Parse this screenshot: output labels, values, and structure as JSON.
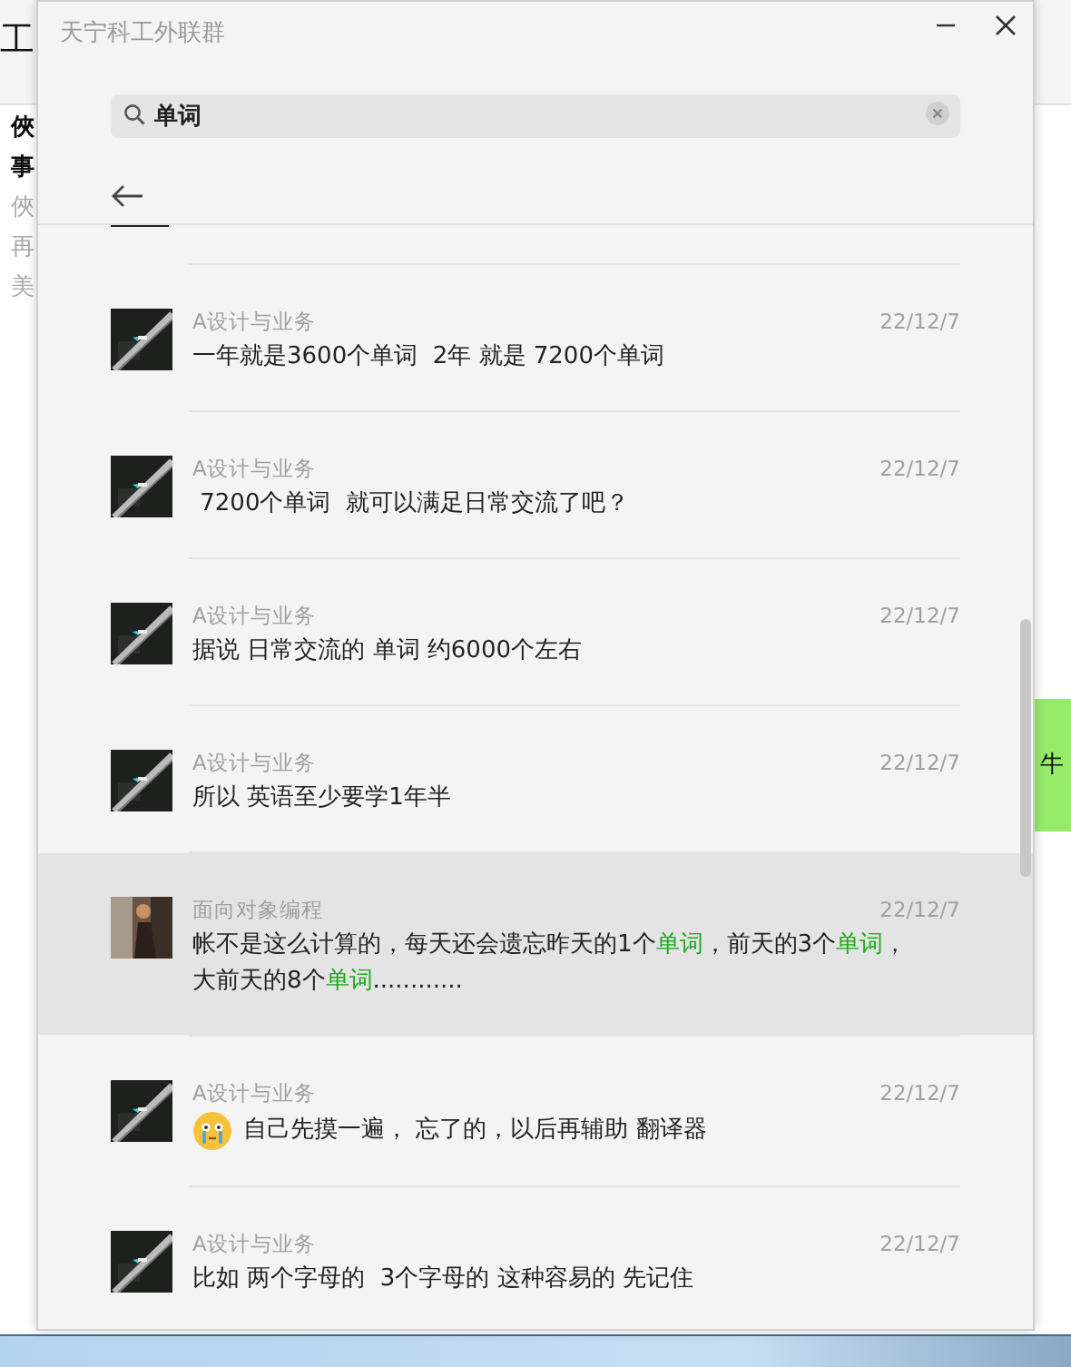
{
  "background_window": {
    "title_fragment": "工",
    "preview_lines": [
      {
        "text": "俠",
        "bold": true
      },
      {
        "text": "事",
        "bold": true
      },
      {
        "text": "俠",
        "bold": false
      },
      {
        "text": "再",
        "bold": false
      },
      {
        "text": "美",
        "bold": false
      }
    ],
    "bubble_fragment": "牛"
  },
  "window": {
    "title": "天宁科工外联群"
  },
  "search": {
    "value": "单词"
  },
  "results": [
    {
      "sender": "A设计与业务",
      "date": "22/12/7",
      "kind": "rope",
      "selected": false,
      "parts": [
        {
          "kind": "text",
          "text": "一年就是3600个单词  2年 就是 7200个单词",
          "match": false
        }
      ]
    },
    {
      "sender": "A设计与业务",
      "date": "22/12/7",
      "kind": "rope",
      "selected": false,
      "parts": [
        {
          "kind": "text",
          "text": " 7200个单词  就可以满足日常交流了吧？",
          "match": false
        }
      ]
    },
    {
      "sender": "A设计与业务",
      "date": "22/12/7",
      "kind": "rope",
      "selected": false,
      "parts": [
        {
          "kind": "text",
          "text": "据说 日常交流的 单词 约6000个左右",
          "match": false
        }
      ]
    },
    {
      "sender": "A设计与业务",
      "date": "22/12/7",
      "kind": "rope",
      "selected": false,
      "parts": [
        {
          "kind": "text",
          "text": "所以 英语至少要学1年半",
          "match": false
        }
      ]
    },
    {
      "sender": "面向对象编程",
      "date": "22/12/7",
      "selected": true,
      "parts": [
        {
          "kind": "text",
          "text": "帐不是这么计算的，每天还会遗忘昨天的1个",
          "match": false
        },
        {
          "kind": "text",
          "text": "单词",
          "match": true
        },
        {
          "kind": "text",
          "text": "，前天的3个",
          "match": false
        },
        {
          "kind": "text",
          "text": "单词",
          "match": true
        },
        {
          "kind": "text",
          "text": "，大前天的8个",
          "match": false
        },
        {
          "kind": "text",
          "text": "单词",
          "match": true
        },
        {
          "kind": "text",
          "text": "............",
          "match": false
        }
      ]
    },
    {
      "sender": "A设计与业务",
      "date": "22/12/7",
      "kind": "rope",
      "selected": false,
      "parts": [
        {
          "kind": "emoji"
        },
        {
          "kind": "text",
          "text": "自己先摸一遍， 忘了的，以后再辅助 翻译器",
          "match": false
        }
      ]
    },
    {
      "sender": "A设计与业务",
      "date": "22/12/7",
      "kind": "rope",
      "selected": false,
      "parts": [
        {
          "kind": "text",
          "text": "比如 两个字母的  3个字母的 这种容易的 先记住",
          "match": false
        }
      ]
    }
  ]
}
